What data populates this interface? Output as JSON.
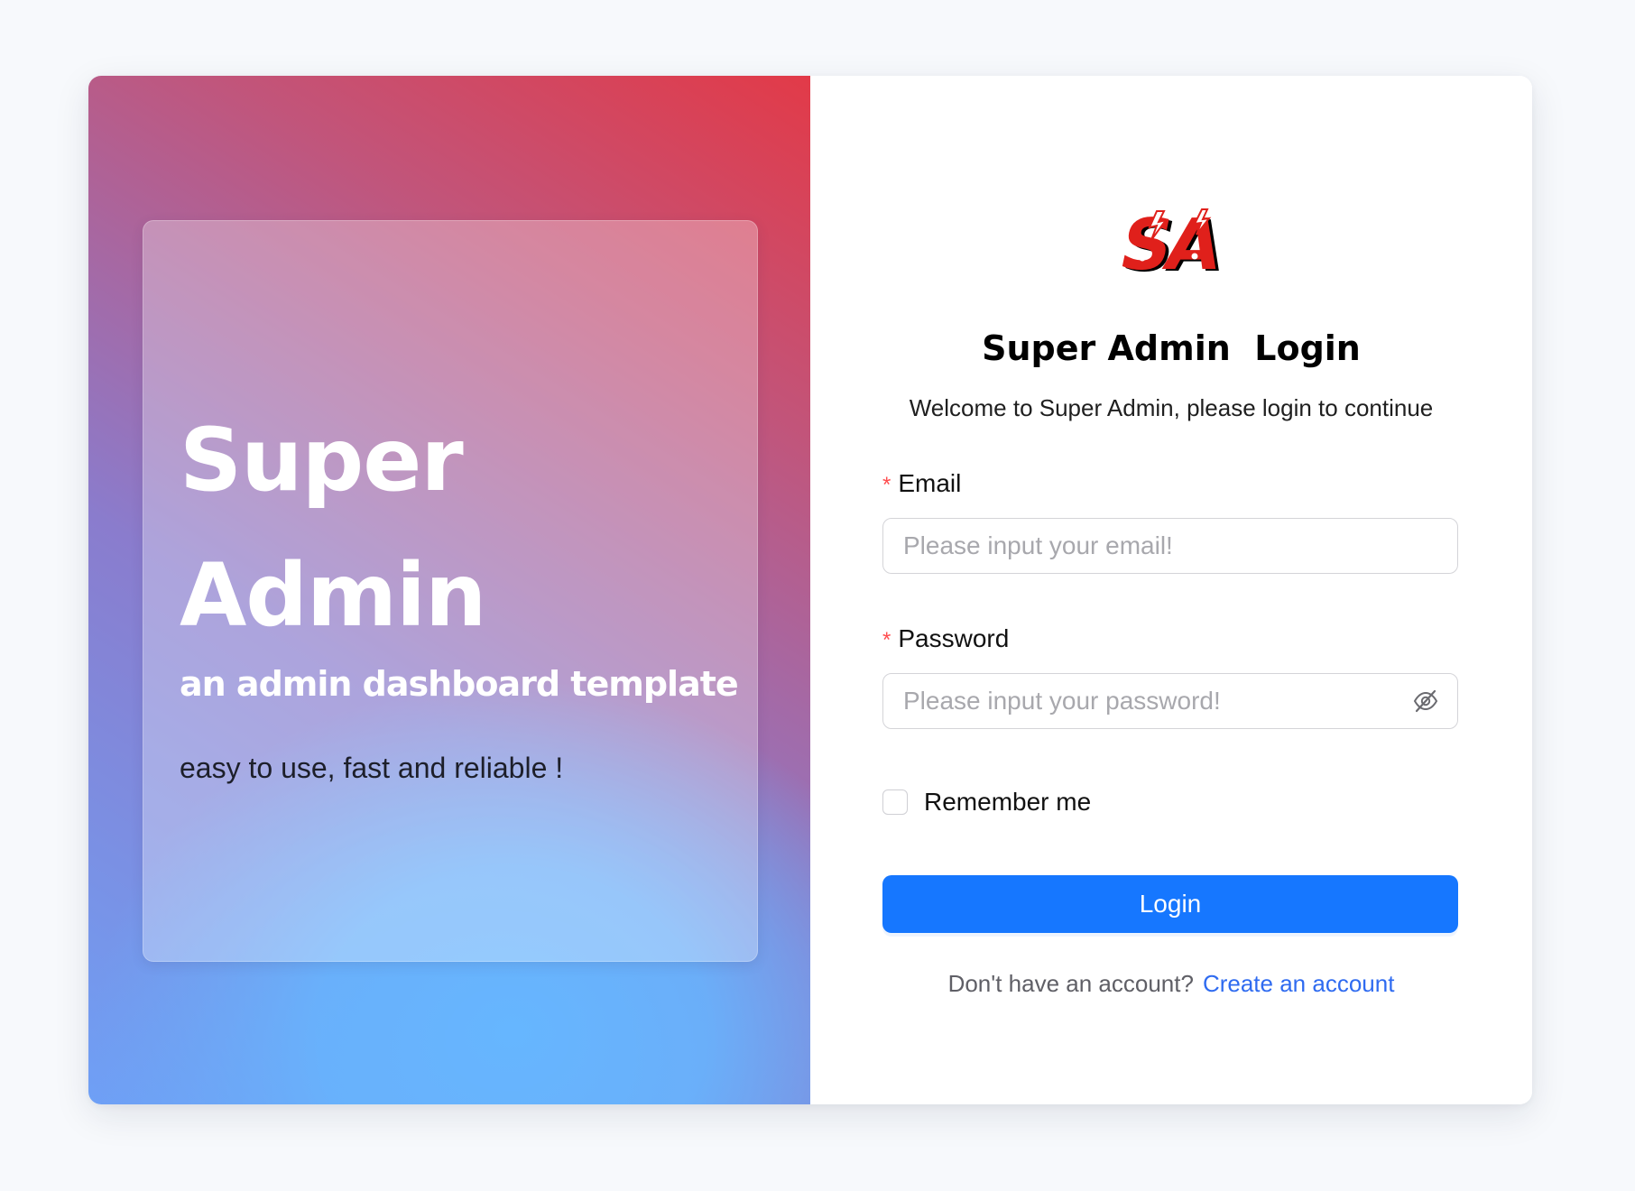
{
  "hero": {
    "title_line1": "Super",
    "title_line2": "Admin",
    "subtitle": "an admin dashboard template",
    "tagline": "easy to use, fast and reliable !"
  },
  "form": {
    "logo_text": "SA",
    "title": "Super Admin  Login",
    "welcome": "Welcome to Super Admin, please login to continue",
    "email": {
      "required_mark": "*",
      "label": "Email",
      "placeholder": "Please input your email!",
      "value": ""
    },
    "password": {
      "required_mark": "*",
      "label": "Password",
      "placeholder": "Please input your password!",
      "value": "",
      "toggle_icon": "eye-invisible-icon"
    },
    "remember": {
      "label": "Remember me",
      "checked": false
    },
    "login_label": "Login",
    "signup_prompt": "Don't have an account?",
    "signup_link": "Create an account"
  },
  "colors": {
    "page_background": "#f7f9fc",
    "primary_button": "#1677ff",
    "link": "#2f6bf0",
    "required": "#ff4d4f",
    "logo_red": "#e0201b",
    "hero_gradient": [
      "#6ea0f6",
      "#8a7ccd",
      "#c1557b",
      "#e23a48"
    ]
  }
}
